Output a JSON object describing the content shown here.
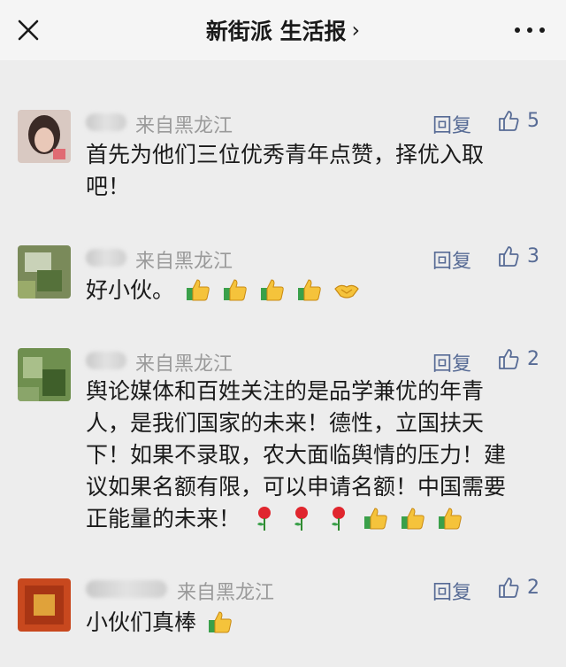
{
  "header": {
    "title": "新街派 生活报",
    "chevron": "›",
    "close_icon": "close-icon",
    "more_icon": "more-dots-icon"
  },
  "comments": [
    {
      "location": "来自黑龙江",
      "reply_label": "回复",
      "likes": "5",
      "content_lines": [
        "首先为他们三位优秀青年点赞，择优入取",
        "吧！"
      ],
      "emojis": []
    },
    {
      "location": "来自黑龙江",
      "reply_label": "回复",
      "likes": "3",
      "content_lines": [
        "好小伙。"
      ],
      "emojis": [
        "thumbs-up",
        "thumbs-up",
        "thumbs-up",
        "thumbs-up",
        "handshake"
      ]
    },
    {
      "location": "来自黑龙江",
      "reply_label": "回复",
      "likes": "2",
      "content_lines": [
        "舆论媒体和百姓关注的是品学兼优的年青",
        "人，是我们国家的未来！德性，立国扶天",
        "下！如果不录取，农大面临舆情的压力！建",
        "议如果名额有限，可以申请名额！中国需要",
        "正能量的未来！"
      ],
      "emojis": [
        "rose",
        "rose",
        "rose",
        "thumbs-up",
        "thumbs-up",
        "thumbs-up"
      ]
    },
    {
      "location": "来自黑龙江",
      "reply_label": "回复",
      "likes": "2",
      "content_lines": [
        "小伙们真棒"
      ],
      "emojis": [
        "thumbs-up"
      ]
    }
  ],
  "colors": {
    "link": "#576b95",
    "meta_gray": "#9a9a9a",
    "background": "#ededed"
  }
}
